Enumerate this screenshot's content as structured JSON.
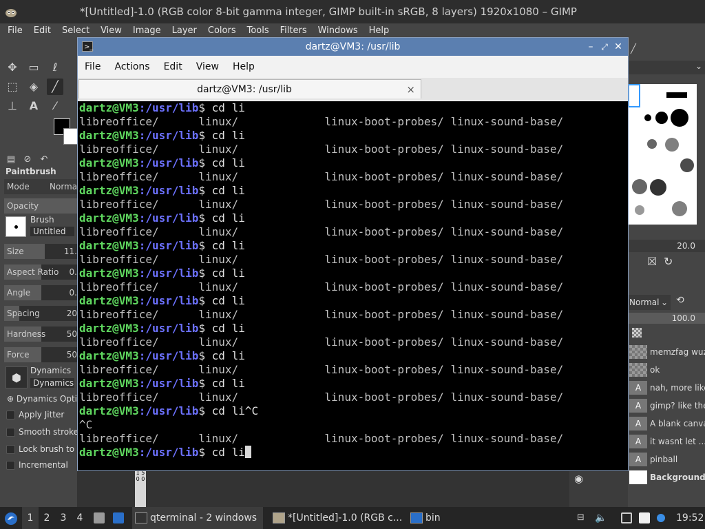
{
  "gimp": {
    "title": "*[Untitled]-1.0 (RGB color 8-bit gamma integer, GIMP built-in sRGB, 8 layers) 1920x1080 – GIMP",
    "menu": [
      "File",
      "Edit",
      "Select",
      "View",
      "Image",
      "Layer",
      "Colors",
      "Tools",
      "Filters",
      "Windows",
      "Help"
    ],
    "tool_options": {
      "tool_name": "Paintbrush",
      "mode_label": "Mode",
      "mode_value": "Norma",
      "opacity_label": "Opacity",
      "brush_label": "Brush",
      "brush_value": "Untitled",
      "size_label": "Size",
      "size_value": "11.",
      "aspect_label": "Aspect Ratio",
      "aspect_value": "0.",
      "angle_label": "Angle",
      "angle_value": "0.",
      "spacing_label": "Spacing",
      "spacing_value": "20",
      "hardness_label": "Hardness",
      "hardness_value": "50",
      "force_label": "Force",
      "force_value": "50",
      "dynamics_label": "Dynamics",
      "dynamics_value": "Dynamics",
      "dynamics_options": "Dynamics Opti",
      "apply_jitter": "Apply Jitter",
      "smooth_stroke": "Smooth stroke",
      "lock_brush": "Lock brush to v",
      "incremental": "Incremental"
    },
    "right_panel": {
      "brush_spacing_value": "20.0",
      "layer_mode": "Normal",
      "layer_opacity": "100.0",
      "layers": [
        {
          "name": "memzfag wuz",
          "thumb": ""
        },
        {
          "name": "ok",
          "thumb": ""
        },
        {
          "name": "nah, more like",
          "thumb": "A"
        },
        {
          "name": "gimp? like the",
          "thumb": "A"
        },
        {
          "name": "A blank canva",
          "thumb": "A"
        },
        {
          "name": "it wasnt let ...",
          "thumb": "A"
        },
        {
          "name": "pinball",
          "thumb": "A"
        },
        {
          "name": "Background",
          "thumb": ""
        }
      ]
    },
    "ruler_text": "1 5 0 0"
  },
  "terminal": {
    "title": "dartz@VM3: /usr/lib",
    "menu": [
      "File",
      "Actions",
      "Edit",
      "View",
      "Help"
    ],
    "tab_label": "dartz@VM3: /usr/lib",
    "tab_close": "×",
    "prompt_user": "dartz@VM3",
    "prompt_path": ":/usr/lib",
    "prompt_symbol": "$ ",
    "lines": [
      {
        "type": "prompt",
        "cmd": "cd li"
      },
      {
        "type": "out",
        "text": "libreoffice/      linux/             linux-boot-probes/ linux-sound-base/"
      },
      {
        "type": "prompt",
        "cmd": "cd li"
      },
      {
        "type": "out",
        "text": "libreoffice/      linux/             linux-boot-probes/ linux-sound-base/"
      },
      {
        "type": "prompt",
        "cmd": "cd li"
      },
      {
        "type": "out",
        "text": "libreoffice/      linux/             linux-boot-probes/ linux-sound-base/"
      },
      {
        "type": "prompt",
        "cmd": "cd li"
      },
      {
        "type": "out",
        "text": "libreoffice/      linux/             linux-boot-probes/ linux-sound-base/"
      },
      {
        "type": "prompt",
        "cmd": "cd li"
      },
      {
        "type": "out",
        "text": "libreoffice/      linux/             linux-boot-probes/ linux-sound-base/"
      },
      {
        "type": "prompt",
        "cmd": "cd li"
      },
      {
        "type": "out",
        "text": "libreoffice/      linux/             linux-boot-probes/ linux-sound-base/"
      },
      {
        "type": "prompt",
        "cmd": "cd li"
      },
      {
        "type": "out",
        "text": "libreoffice/      linux/             linux-boot-probes/ linux-sound-base/"
      },
      {
        "type": "prompt",
        "cmd": "cd li"
      },
      {
        "type": "out",
        "text": "libreoffice/      linux/             linux-boot-probes/ linux-sound-base/"
      },
      {
        "type": "prompt",
        "cmd": "cd li"
      },
      {
        "type": "out",
        "text": "libreoffice/      linux/             linux-boot-probes/ linux-sound-base/"
      },
      {
        "type": "prompt",
        "cmd": "cd li"
      },
      {
        "type": "out",
        "text": "libreoffice/      linux/             linux-boot-probes/ linux-sound-base/"
      },
      {
        "type": "prompt",
        "cmd": "cd li"
      },
      {
        "type": "out",
        "text": "libreoffice/      linux/             linux-boot-probes/ linux-sound-base/"
      },
      {
        "type": "prompt",
        "cmd": "cd li^C"
      },
      {
        "type": "out",
        "text": "^C"
      },
      {
        "type": "out",
        "text": "libreoffice/      linux/             linux-boot-probes/ linux-sound-base/"
      },
      {
        "type": "prompt",
        "cmd": "cd li",
        "cursor": true
      }
    ]
  },
  "taskbar": {
    "desktops": [
      "1",
      "2",
      "3",
      "4"
    ],
    "active_desktop": 0,
    "tasks": [
      {
        "label": "qterminal - 2 windows",
        "icon": "terminal-icon"
      },
      {
        "label": "*[Untitled]-1.0 (RGB c...",
        "icon": "gimp-icon"
      },
      {
        "label": "bin",
        "icon": "folder-icon"
      }
    ],
    "clock": "19:52"
  },
  "colors": {
    "prompt_user": "#5fd75f",
    "prompt_path": "#6c71ff",
    "terminal_bg": "#000000",
    "titlebar": "#5b7fb0"
  }
}
